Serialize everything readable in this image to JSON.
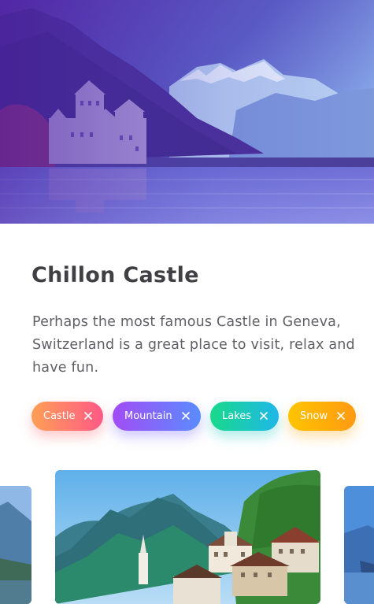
{
  "place": {
    "title": "Chillon Castle",
    "description": "Perhaps the most famous Castle in Geneva, Switzerland is a great place to visit, relax and have fun."
  },
  "tags": [
    {
      "label": "Castle",
      "remove_icon": "close-icon"
    },
    {
      "label": "Mountain",
      "remove_icon": "close-icon"
    },
    {
      "label": "Lakes",
      "remove_icon": "close-icon"
    },
    {
      "label": "Snow",
      "remove_icon": "close-icon"
    }
  ],
  "colors": {
    "title": "#3f3f44",
    "text": "#5f5f66",
    "castle_tag": [
      "#ff9f56",
      "#ff5a86"
    ],
    "mountain_tag": [
      "#a24cf5",
      "#5a8cff"
    ],
    "lakes_tag": [
      "#19d98a",
      "#1fb7e8"
    ],
    "snow_tag": [
      "#ffc400",
      "#ff9a12"
    ]
  }
}
